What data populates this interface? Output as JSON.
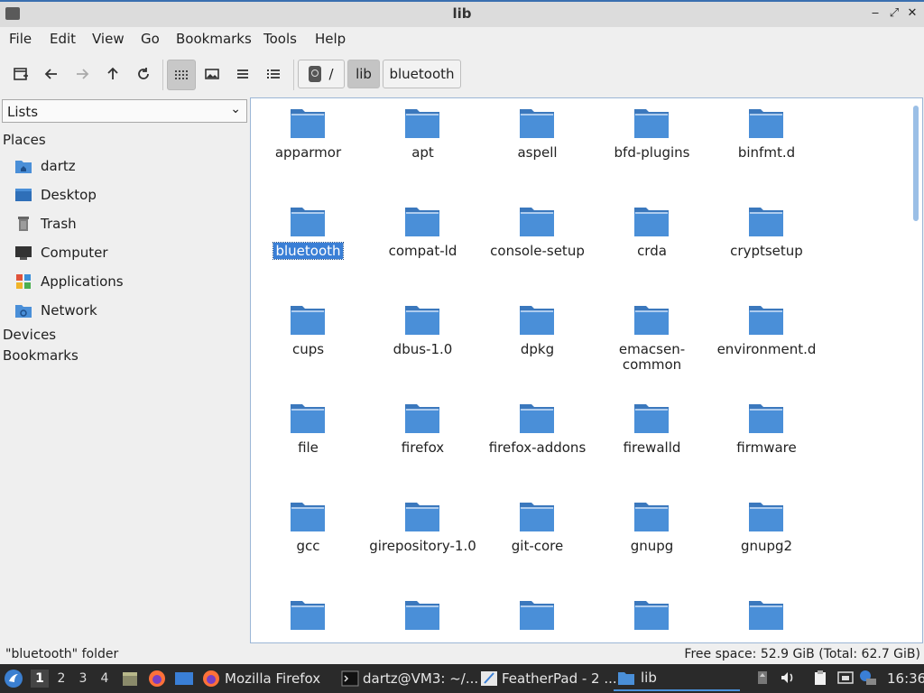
{
  "window": {
    "title": "lib"
  },
  "window_controls": {
    "minimize": "‒",
    "maximize": "⤢",
    "close": "✕"
  },
  "menu": [
    "File",
    "Edit",
    "View",
    "Go",
    "Bookmarks",
    "Tools",
    "Help"
  ],
  "breadcrumb": {
    "root": "/",
    "items": [
      "lib",
      "bluetooth"
    ],
    "current": "lib"
  },
  "sidebar": {
    "combo": {
      "label": "Lists",
      "chevron": "⌄"
    },
    "places_label": "Places",
    "places": [
      {
        "label": "dartz",
        "icon": "home-folder-icon"
      },
      {
        "label": "Desktop",
        "icon": "desktop-icon"
      },
      {
        "label": "Trash",
        "icon": "trash-icon"
      },
      {
        "label": "Computer",
        "icon": "computer-icon"
      },
      {
        "label": "Applications",
        "icon": "applications-icon"
      },
      {
        "label": "Network",
        "icon": "network-icon"
      }
    ],
    "devices_label": "Devices",
    "bookmarks_label": "Bookmarks"
  },
  "files": [
    "apparmor",
    "apt",
    "aspell",
    "bfd-plugins",
    "binfmt.d",
    "bluetooth",
    "compat-ld",
    "console-setup",
    "crda",
    "cryptsetup",
    "cups",
    "dbus-1.0",
    "dpkg",
    "emacsen-common",
    "environment.d",
    "file",
    "firefox",
    "firefox-addons",
    "firewalld",
    "firmware",
    "gcc",
    "girepository-1.0",
    "git-core",
    "gnupg",
    "gnupg2",
    "",
    "",
    "",
    "",
    ""
  ],
  "selected_file": "bluetooth",
  "status": {
    "left": "\"bluetooth\" folder",
    "right": "Free space: 52.9 GiB (Total: 62.7 GiB)"
  },
  "taskbar": {
    "workspaces": [
      "1",
      "2",
      "3",
      "4"
    ],
    "current_workspace": "1",
    "tasks": [
      {
        "label": "Mozilla Firefox",
        "icon": "firefox-icon"
      },
      {
        "label": "dartz@VM3: ~/...",
        "icon": "terminal-icon"
      },
      {
        "label": "FeatherPad - 2 ...",
        "icon": "featherpad-icon"
      },
      {
        "label": "lib",
        "icon": "folder-icon"
      }
    ],
    "clock": "16:36"
  },
  "colors": {
    "folder": "#4a8fd8",
    "folder_dark": "#3b78bd",
    "selection": "#3a7fd6",
    "taskbar": "#2a2a2a"
  }
}
